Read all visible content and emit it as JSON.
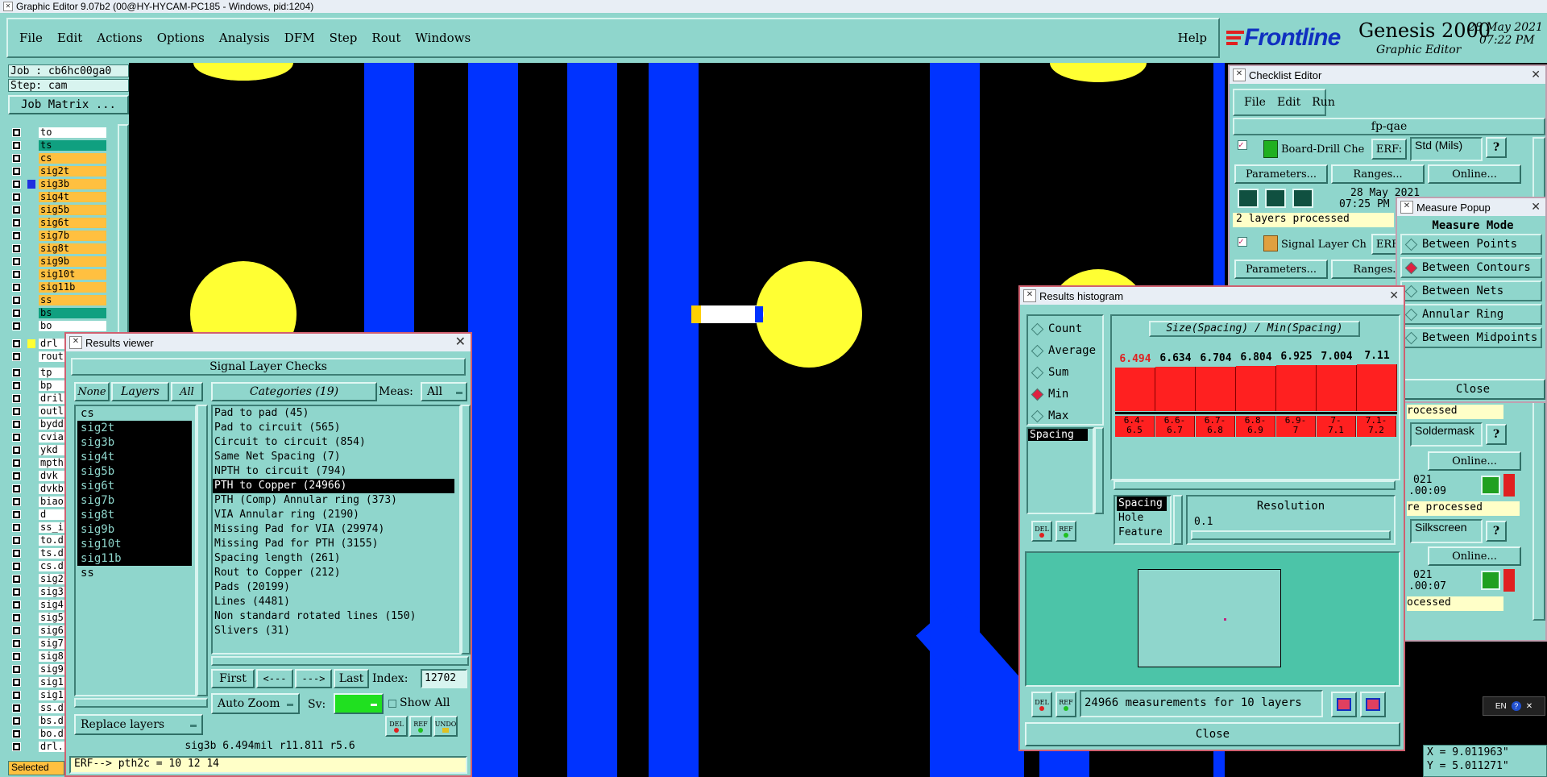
{
  "window_title": "Graphic Editor 9.07b2 (00@HY-HYCAM-PC185 - Windows, pid:1204)",
  "menu": [
    "File",
    "Edit",
    "Actions",
    "Options",
    "Analysis",
    "DFM",
    "Step",
    "Rout",
    "Windows"
  ],
  "help": "Help",
  "brand": {
    "logo": "Frontline",
    "product": "Genesis 2000",
    "subtitle": "Graphic Editor",
    "date": "28 May 2021",
    "time": "07:22 PM"
  },
  "colors": {
    "teal": "#8fd6cc",
    "canvas": "#000000",
    "pad": "#ffff33",
    "track": "#0033ff",
    "layer_orange": "#ffc040",
    "layer_green": "#10a080",
    "hist_bar": "#ff2020"
  },
  "left_panel": {
    "job": "Job : cb6hc00ga0",
    "step": "Step: cam",
    "job_matrix": "Job Matrix ...",
    "board_layers": [
      "to",
      "ts",
      "cs",
      "sig2t",
      "sig3b",
      "sig4t",
      "sig5b",
      "sig6t",
      "sig7b",
      "sig8t",
      "sig9b",
      "sig10t",
      "sig11b",
      "ss",
      "bs",
      "bo"
    ],
    "drill_layers": [
      "drl",
      "rout"
    ],
    "misc_layers": [
      "tp",
      "bp",
      "dril",
      "outl",
      "bydd",
      "cvia",
      "ykd",
      "mpth",
      "dvk",
      "dvkb",
      "biao",
      "d",
      "ss_i",
      "to.d",
      "ts.d",
      "cs.d",
      "sig2",
      "sig3",
      "sig4",
      "sig5",
      "sig6",
      "sig7",
      "sig8",
      "sig9",
      "sig1",
      "sig1",
      "ss.d",
      "bs.d",
      "bo.d",
      "drl."
    ],
    "selected": "Selected"
  },
  "results_viewer": {
    "title": "Results viewer",
    "header": "Signal Layer Checks",
    "none": "None",
    "layers_label": "Layers",
    "all": "All",
    "categories_label": "Categories (19)",
    "meas_label": "Meas:",
    "meas_value": "All",
    "layers": [
      "cs",
      "sig2t",
      "sig3b",
      "sig4t",
      "sig5b",
      "sig6t",
      "sig7b",
      "sig8t",
      "sig9b",
      "sig10t",
      "sig11b",
      "ss"
    ],
    "categories": [
      "Pad to pad (45)",
      "Pad to circuit (565)",
      "Circuit to circuit (854)",
      "Same Net Spacing (7)",
      "NPTH to circuit (794)",
      "PTH to Copper (24966)",
      "PTH (Comp) Annular ring (373)",
      "VIA Annular ring (2190)",
      "Missing Pad for VIA (29974)",
      "Missing Pad for PTH (3155)",
      "Spacing length (261)",
      "Rout to Copper (212)",
      "Pads (20199)",
      "Lines (4481)",
      "Non standard rotated lines (150)",
      "Slivers (31)"
    ],
    "first": "First",
    "prev": "<---",
    "next": "--->",
    "last": "Last",
    "index_label": "Index:",
    "index_value": "12702",
    "auto_zoom": "Auto Zoom",
    "sv_label": "Sv:",
    "show_all": "Show All",
    "replace_layers": "Replace layers",
    "del": "DEL",
    "ref": "REF",
    "undo": "UNDO",
    "status": "sig3b 6.494mil  r11.811  r5.6",
    "erf_line": "ERF--> pth2c = 10 12 14"
  },
  "checklist": {
    "title": "Checklist Editor",
    "menu": [
      "File",
      "Edit",
      "Run"
    ],
    "name": "fp-qae",
    "check1": {
      "name": "Board-Drill Che",
      "erf": "ERF:",
      "erf_value": "Std (Mils)",
      "help": "?",
      "params": "Parameters...",
      "ranges": "Ranges...",
      "online": "Online...",
      "date": "28 May 2021",
      "time": "07:25 PM",
      "processed": "2 layers processed"
    },
    "check2": {
      "name": "Signal Layer Ch",
      "erf": "ERF",
      "params": "Parameters...",
      "ranges": "Ranges..."
    },
    "check3": {
      "processed": "rocessed",
      "erf_value": "Soldermask",
      "help": "?",
      "online": "Online...",
      "date": "021",
      "time": ".00:09",
      "processed2": "re processed"
    },
    "check4": {
      "erf_value": "Silkscreen",
      "help": "?",
      "online": "Online...",
      "date": "021",
      "time": ".00:07",
      "processed": "ocessed"
    }
  },
  "measure_popup": {
    "title": "Measure Popup",
    "mode_label": "Measure Mode",
    "modes": [
      "Between Points",
      "Between Contours",
      "Between Nets",
      "Annular Ring",
      "Between Midpoints"
    ],
    "selected_mode": 1,
    "close": "Close"
  },
  "histogram": {
    "title": "Results histogram",
    "stats": [
      "Count",
      "Average",
      "Sum",
      "Min",
      "Max"
    ],
    "selected_stat": 3,
    "spacing_item": "Spacing",
    "del": "DEL",
    "ref": "REF",
    "chart_title": "Size(Spacing) / Min(Spacing)",
    "resolution_label": "Resolution",
    "resolution_value": "0.1",
    "fields": [
      "Spacing",
      "Hole",
      "Feature"
    ],
    "summary": "24966 measurements for 10 layers",
    "close": "Close"
  },
  "chart_data": {
    "type": "bar",
    "title": "Size(Spacing) / Min(Spacing)",
    "categories": [
      "6.4-6.5",
      "6.6-6.7",
      "6.7-6.8",
      "6.8-6.9",
      "6.9-7",
      "7-7.1",
      "7.1-7.2"
    ],
    "values": [
      6.494,
      6.634,
      6.704,
      6.804,
      6.925,
      7.004,
      7.11
    ],
    "value_labels": [
      "6.494",
      "6.634",
      "6.704",
      "6.804",
      "6.925",
      "7.004",
      "7.11"
    ],
    "category_lines": [
      [
        "6.4-",
        "6.5"
      ],
      [
        "6.6-",
        "6.7"
      ],
      [
        "6.7-",
        "6.8"
      ],
      [
        "6.8-",
        "6.9"
      ],
      [
        "6.9-",
        "7"
      ],
      [
        "7-",
        "7.1"
      ],
      [
        "7.1-",
        "7.2"
      ]
    ],
    "highlight_index": 0
  },
  "coords": {
    "x": "X = 9.011963\"",
    "y": "Y = 5.011271\""
  },
  "lang": "EN"
}
